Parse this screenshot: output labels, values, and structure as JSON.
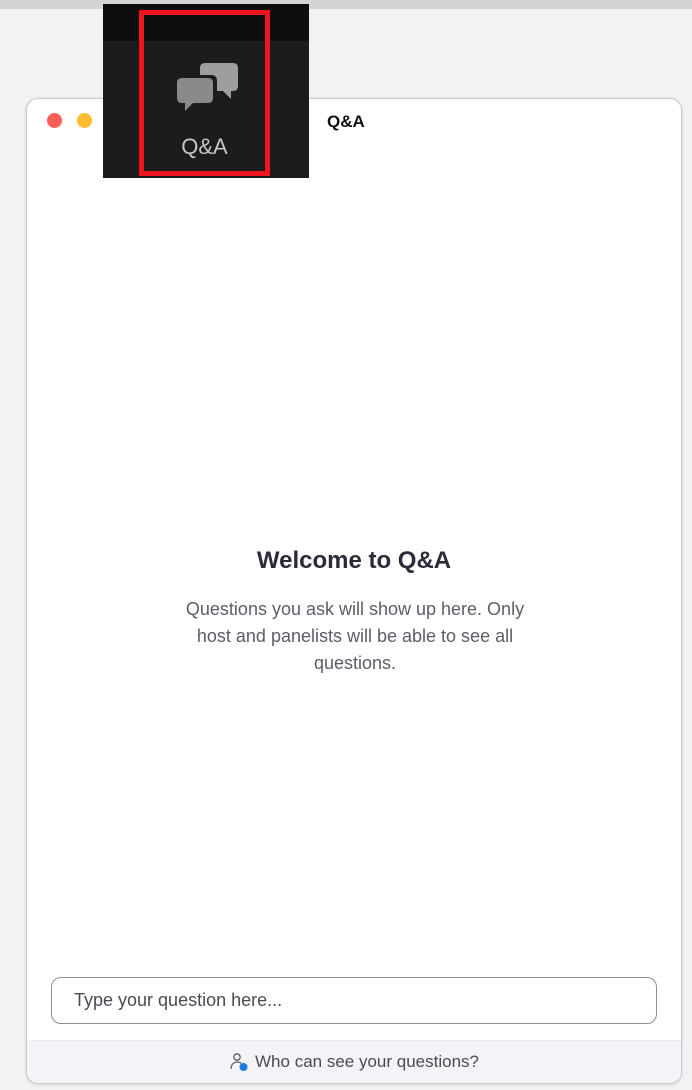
{
  "window": {
    "title": "Q&A"
  },
  "toolbar": {
    "qa_label": "Q&A"
  },
  "empty_state": {
    "heading": "Welcome to Q&A",
    "description": "Questions you ask will show up here. Only host and panelists will be able to see all questions."
  },
  "input": {
    "placeholder": "Type your question here..."
  },
  "footer": {
    "link_text": "Who can see your questions?"
  },
  "icons": {
    "toolbar": "chat-bubbles-icon",
    "footer": "person-info-icon"
  },
  "colors": {
    "highlight": "#f2141d",
    "traffic_close": "#ff5f57",
    "traffic_minimize": "#febc2e",
    "footer_accent": "#1f7ae0"
  }
}
